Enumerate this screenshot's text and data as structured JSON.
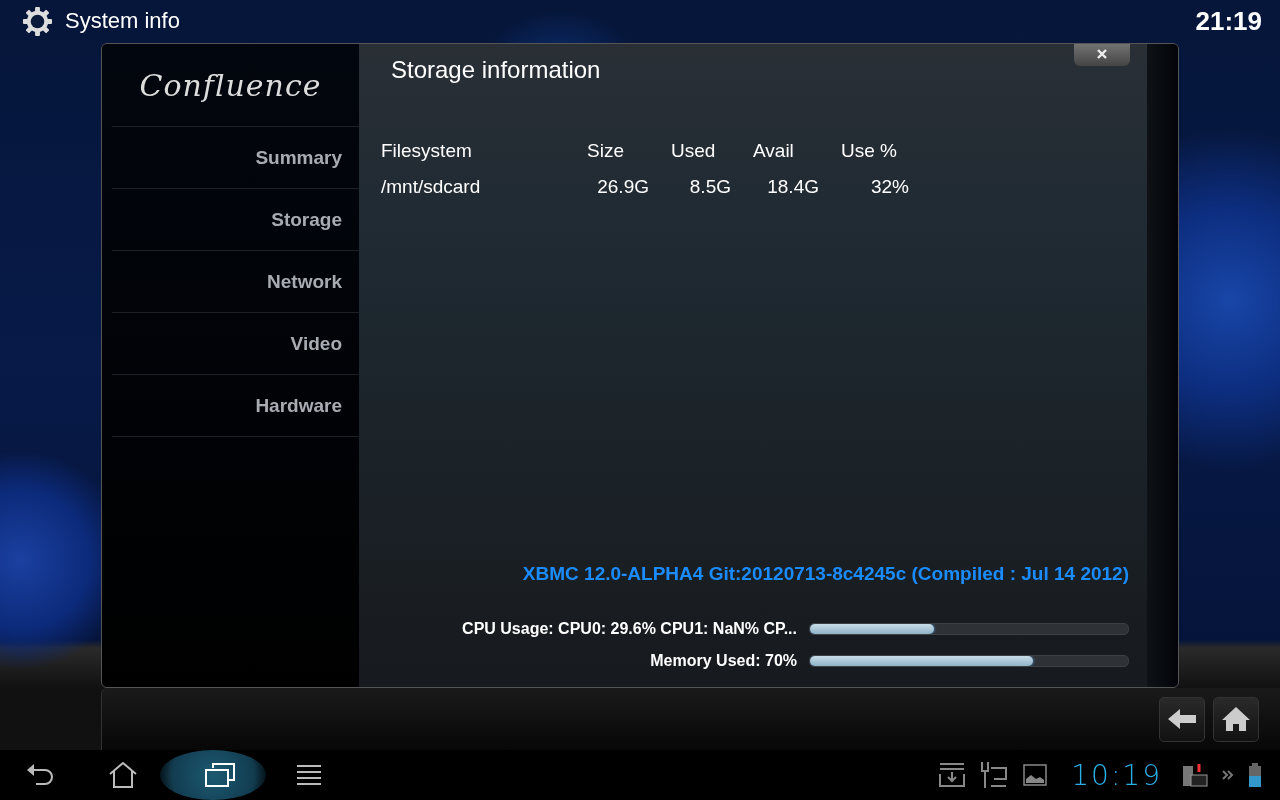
{
  "header": {
    "title": "System info",
    "clock": "21:19"
  },
  "dialog": {
    "logo": "Confluence",
    "heading": "Storage information",
    "sidebar": {
      "items": [
        {
          "label": "Summary"
        },
        {
          "label": "Storage"
        },
        {
          "label": "Network"
        },
        {
          "label": "Video"
        },
        {
          "label": "Hardware"
        }
      ]
    },
    "table": {
      "columns": [
        "Filesystem",
        "Size",
        "Used",
        "Avail",
        "Use %"
      ],
      "rows": [
        [
          "/mnt/sdcard",
          "26.9G",
          "8.5G",
          "18.4G",
          "32%"
        ]
      ]
    },
    "version": "XBMC 12.0-ALPHA4 Git:20120713-8c4245c (Compiled : Jul 14 2012)",
    "meters": [
      {
        "label": "CPU Usage: CPU0: 29.6% CPU1: NaN% CP...",
        "level": 0.39
      },
      {
        "label": "Memory Used: 70%",
        "level": 0.7
      }
    ]
  },
  "status_bar": {
    "clock": "10:19"
  }
}
